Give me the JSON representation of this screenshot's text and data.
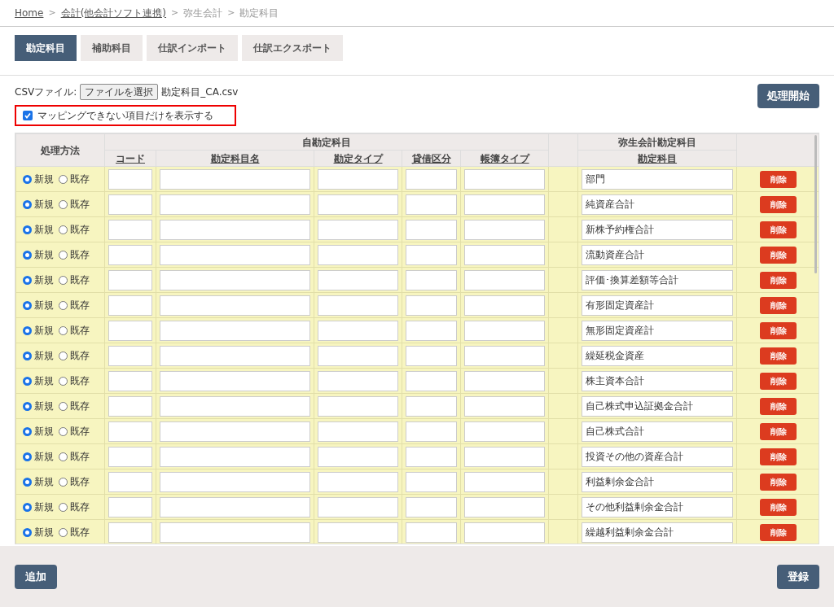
{
  "breadcrumb": [
    {
      "label": "Home",
      "link": true
    },
    {
      "label": "会計(他会計ソフト連携)",
      "link": true
    },
    {
      "label": "弥生会計",
      "link": false
    },
    {
      "label": "勘定科目",
      "link": false
    }
  ],
  "breadcrumb_separator": ">",
  "tabs": [
    {
      "label": "勘定科目",
      "selected": true
    },
    {
      "label": "補助科目",
      "selected": false
    },
    {
      "label": "仕訳インポート",
      "selected": false
    },
    {
      "label": "仕訳エクスポート",
      "selected": false
    }
  ],
  "file": {
    "label": "CSVファイル:",
    "button": "ファイルを選択",
    "filename": "勘定科目_CA.csv"
  },
  "start_button": "処理開始",
  "filter": {
    "label": "マッピングできない項目だけを表示する",
    "checked": true
  },
  "table": {
    "method_header": "処理方法",
    "own_group": "自勘定科目",
    "own_columns": [
      "コード",
      "勘定科目名",
      "勘定タイプ",
      "貸借区分",
      "帳簿タイプ"
    ],
    "yayoi_group": "弥生会計勘定科目",
    "yayoi_column": "勘定科目",
    "rows": [
      {
        "options": [
          {
            "label": "新規",
            "selected": true
          },
          {
            "label": "既存",
            "selected": false
          }
        ],
        "account": "部門",
        "delete": "削除"
      },
      {
        "options": [
          {
            "label": "新規",
            "selected": true
          },
          {
            "label": "既存",
            "selected": false
          }
        ],
        "account": "純資産合計",
        "delete": "削除"
      },
      {
        "options": [
          {
            "label": "新規",
            "selected": true
          },
          {
            "label": "既存",
            "selected": false
          }
        ],
        "account": "新株予約権合計",
        "delete": "削除"
      },
      {
        "options": [
          {
            "label": "新規",
            "selected": true
          },
          {
            "label": "既存",
            "selected": false
          }
        ],
        "account": "流動資産合計",
        "delete": "削除"
      },
      {
        "options": [
          {
            "label": "新規",
            "selected": true
          },
          {
            "label": "既存",
            "selected": false
          }
        ],
        "account": "評価･換算差額等合計",
        "delete": "削除"
      },
      {
        "options": [
          {
            "label": "新規",
            "selected": true
          },
          {
            "label": "既存",
            "selected": false
          }
        ],
        "account": "有形固定資産計",
        "delete": "削除"
      },
      {
        "options": [
          {
            "label": "新規",
            "selected": true
          },
          {
            "label": "既存",
            "selected": false
          }
        ],
        "account": "無形固定資産計",
        "delete": "削除"
      },
      {
        "options": [
          {
            "label": "新規",
            "selected": true
          },
          {
            "label": "既存",
            "selected": false
          }
        ],
        "account": "繰延税金資産",
        "delete": "削除"
      },
      {
        "options": [
          {
            "label": "新規",
            "selected": true
          },
          {
            "label": "既存",
            "selected": false
          }
        ],
        "account": "株主資本合計",
        "delete": "削除"
      },
      {
        "options": [
          {
            "label": "新規",
            "selected": true
          },
          {
            "label": "既存",
            "selected": false
          }
        ],
        "account": "自己株式申込証拠金合計",
        "delete": "削除"
      },
      {
        "options": [
          {
            "label": "新規",
            "selected": true
          },
          {
            "label": "既存",
            "selected": false
          }
        ],
        "account": "自己株式合計",
        "delete": "削除"
      },
      {
        "options": [
          {
            "label": "新規",
            "selected": true
          },
          {
            "label": "既存",
            "selected": false
          }
        ],
        "account": "投資その他の資産合計",
        "delete": "削除"
      },
      {
        "options": [
          {
            "label": "新規",
            "selected": true
          },
          {
            "label": "既存",
            "selected": false
          }
        ],
        "account": "利益剰余金合計",
        "delete": "削除"
      },
      {
        "options": [
          {
            "label": "新規",
            "selected": true
          },
          {
            "label": "既存",
            "selected": false
          }
        ],
        "account": "その他利益剰余金合計",
        "delete": "削除"
      },
      {
        "options": [
          {
            "label": "新規",
            "selected": true
          },
          {
            "label": "既存",
            "selected": false
          }
        ],
        "account": "繰越利益剰余金合計",
        "delete": "削除"
      }
    ]
  },
  "footer": {
    "add_button": "追加",
    "save_button": "登録"
  }
}
